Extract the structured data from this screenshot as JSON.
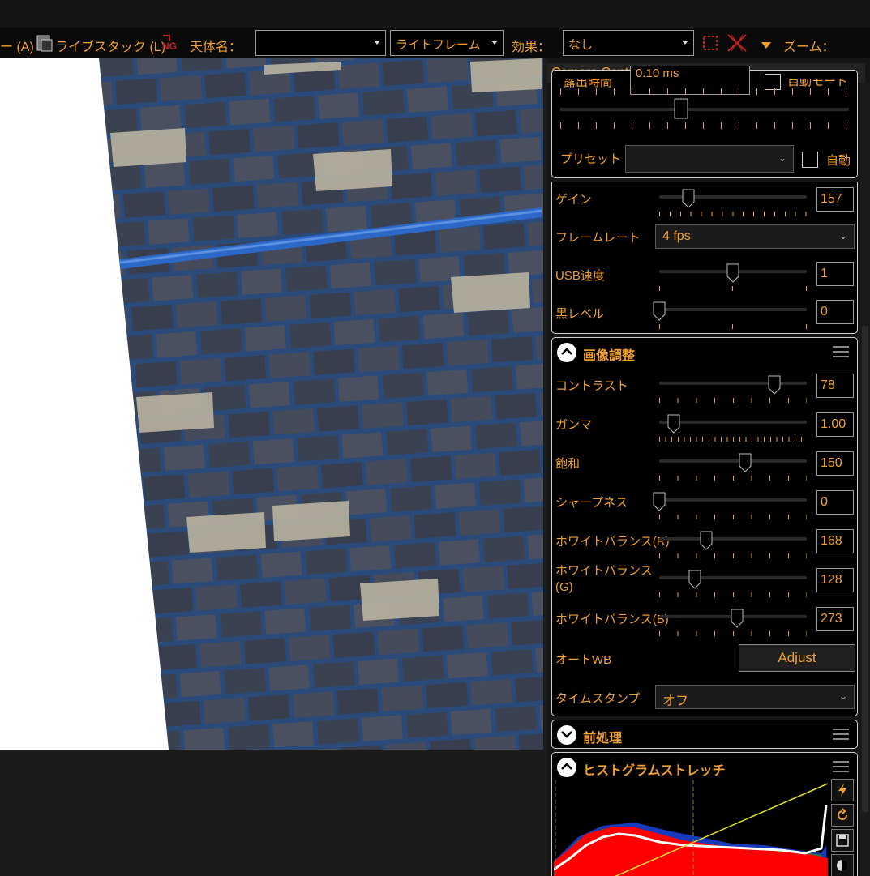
{
  "toolbar": {
    "item_a": "ー (A)",
    "live_stack": "ライブスタック (L)",
    "object_name_label": "天体名：",
    "object_name_value": "",
    "frame_type": "ライトフレーム",
    "effect_label": "効果：",
    "effect_value": "なし",
    "zoom_label": "ズーム："
  },
  "panel": {
    "title": "Camera Control Panel",
    "exposure": {
      "label": "露出時間",
      "value": "0.10 ms",
      "auto_label": "自動モード",
      "preset_label": "プリセット",
      "preset_value": "",
      "preset_auto": "自動"
    },
    "gain": {
      "label": "ゲイン",
      "value": "157",
      "level": 0.2
    },
    "framerate": {
      "label": "フレームレート",
      "value": "4 fps"
    },
    "usb": {
      "label": "USB速度",
      "value": "1",
      "level": 0.5
    },
    "black": {
      "label": "黒レベル",
      "value": "0",
      "level": 0.0
    },
    "image_adjust": {
      "title": "画像調整",
      "contrast": {
        "label": "コントラスト",
        "value": "78",
        "level": 0.78
      },
      "gamma": {
        "label": "ガンマ",
        "value": "1.00",
        "level": 0.1
      },
      "saturation": {
        "label": "飽和",
        "value": "150",
        "level": 0.58
      },
      "sharpness": {
        "label": "シャープネス",
        "value": "0",
        "level": 0.0
      },
      "wb_r": {
        "label": "ホワイトバランス(R)",
        "value": "168",
        "level": 0.32
      },
      "wb_g": {
        "label": "ホワイトバランス\n(G)",
        "value": "128",
        "level": 0.24
      },
      "wb_b": {
        "label": "ホワイトバランス(B)",
        "value": "273",
        "level": 0.53
      },
      "auto_wb": {
        "label": "オートWB",
        "button": "Adjust"
      },
      "timestamp": {
        "label": "タイムスタンプ",
        "value": "オフ"
      }
    },
    "preprocess": {
      "title": "前処理"
    },
    "histogram": {
      "title": "ヒストグラムストレッチ"
    }
  },
  "colors": {
    "accent": "#f0a030",
    "panel_bg": "#000000",
    "toolbar_bg": "#0a0a0a"
  }
}
